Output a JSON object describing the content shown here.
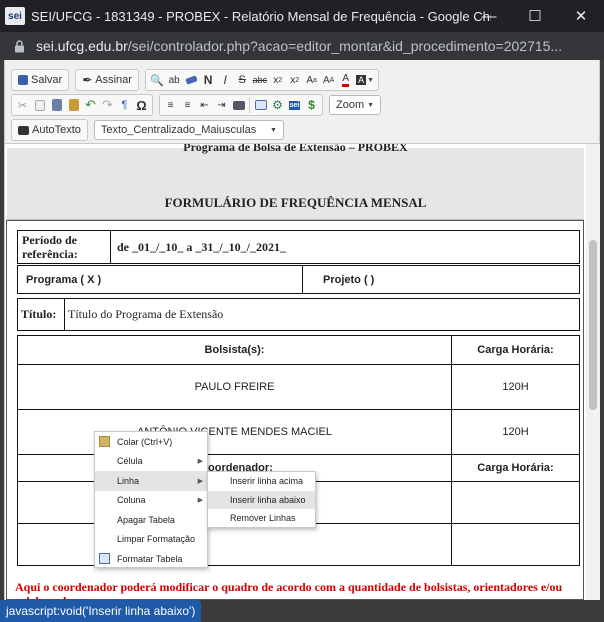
{
  "window": {
    "title": "SEI/UFCG - 1831349 - PROBEX - Relatório Mensal de Frequência - Google Chrome",
    "app_icon_text": "sei"
  },
  "address": {
    "host": "sei.ufcg.edu.br",
    "path": "/sei/controlador.php?acao=editor_montar&id_procedimento=202715..."
  },
  "toolbar": {
    "save_label": "Salvar",
    "sign_label": "Assinar",
    "zoom_label": "Zoom",
    "autotext_label": "AutoTexto",
    "style_value": "Texto_Centralizado_Maiusculas"
  },
  "document": {
    "subtitle": "Programa de Bolsa de Extensão – PROBEX",
    "title": "FORMULÁRIO DE FREQUÊNCIA MENSAL",
    "periodo_label": "Período de referência:",
    "periodo_value": "de _01_/_10_ a _31_/_10_/_2021_",
    "programa_label": "Programa ( X )",
    "projeto_label": "Projeto (   )",
    "titulo_label": "Título:",
    "titulo_value": "Título do Programa de Extensão",
    "bolsistas_header": "Bolsista(s):",
    "carga_header": "Carga Horária:",
    "bolsistas": [
      {
        "name": "PAULO FREIRE",
        "hours": "120H"
      },
      {
        "name": "ANTÔNIO VICENTE MENDES MACIEL",
        "hours": "120H"
      }
    ],
    "coordenador_header": "oordenador:",
    "carga_header_2": "Carga Horária:",
    "note": "Aqui o coordenador poderá modificar o quadro de acordo com a quantidade de bolsistas, orientadores e/ou colaboradores."
  },
  "context_menu": {
    "items": [
      "Colar (Ctrl+V)",
      "Célula",
      "Linha",
      "Coluna",
      "Apagar Tabela",
      "Limpar Formatação",
      "Formatar Tabela"
    ]
  },
  "submenu": {
    "items": [
      "Inserir linha acima",
      "Inserir linha abaixo",
      "Remover Linhas"
    ]
  },
  "status_url": "javascript:void('Inserir linha abaixo')"
}
